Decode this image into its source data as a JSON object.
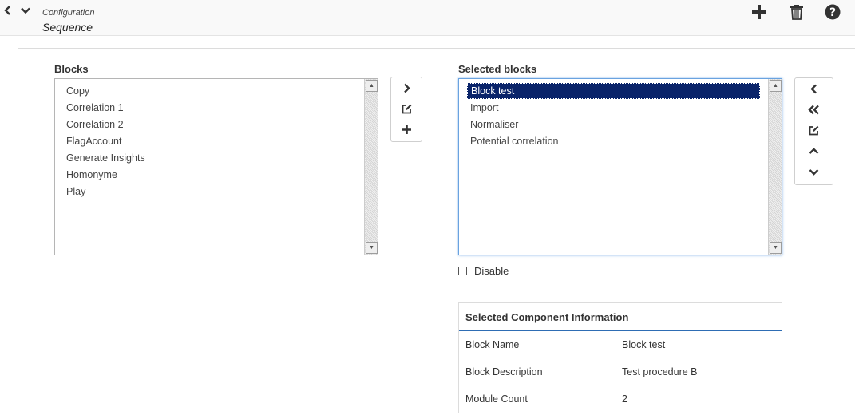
{
  "header": {
    "breadcrumb_small": "Configuration",
    "breadcrumb_title": "Sequence",
    "icons": [
      "chevron-left-icon",
      "chevron-down-icon",
      "plus-icon",
      "trash-icon",
      "help-icon"
    ]
  },
  "blocks": {
    "label": "Blocks",
    "items": [
      "Copy",
      "Correlation 1",
      "Correlation 2",
      "FlagAccount",
      "Generate Insights",
      "Homonyme",
      "Play"
    ]
  },
  "middle_buttons": [
    "chevron-right-icon",
    "edit-icon",
    "plus-icon"
  ],
  "selected_blocks": {
    "label": "Selected blocks",
    "selected_index": 0,
    "items": [
      "Block test",
      "Import",
      "Normaliser",
      "Potential correlation"
    ]
  },
  "right_buttons": [
    "chevron-left-icon",
    "double-chevron-left-icon",
    "edit-icon",
    "chevron-up-icon",
    "chevron-down-icon"
  ],
  "disable": {
    "label": "Disable",
    "checked": false
  },
  "component_info": {
    "title": "Selected Component Information",
    "rows": [
      {
        "key": "Block Name",
        "value": "Block test"
      },
      {
        "key": "Block Description",
        "value": "Test procedure B"
      },
      {
        "key": "Module Count",
        "value": "2"
      }
    ]
  },
  "colors": {
    "accent": "#2e6db4",
    "selection": "#0a246a",
    "focus_border": "#6aa3e0"
  }
}
